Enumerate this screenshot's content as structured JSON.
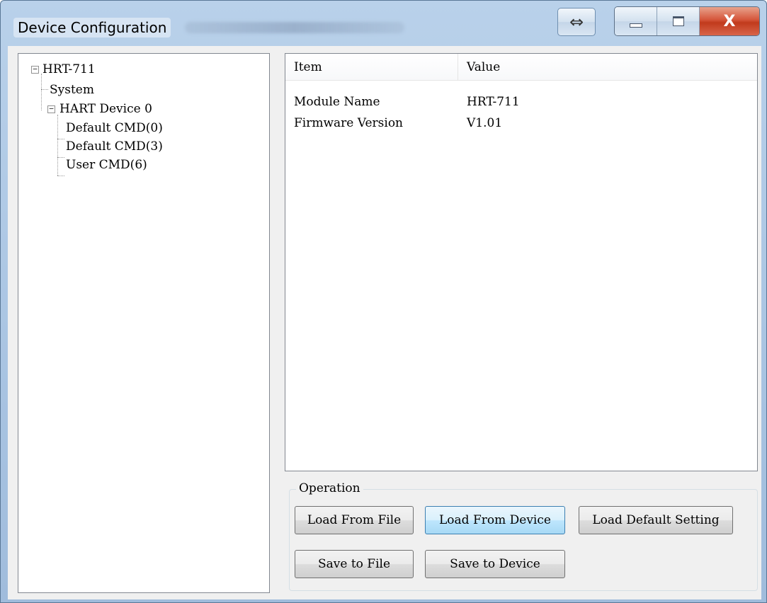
{
  "window": {
    "title": "Device Configuration",
    "snap_glyph": "⇔",
    "close_glyph": "X"
  },
  "tree": {
    "root": {
      "label": "HRT-711",
      "expander": "−"
    },
    "system": {
      "label": "System"
    },
    "hart_device": {
      "label": "HART Device 0",
      "expander": "−"
    },
    "children": [
      {
        "label": "Default CMD(0)"
      },
      {
        "label": "Default CMD(3)"
      },
      {
        "label": "User CMD(6)"
      }
    ]
  },
  "list": {
    "columns": {
      "item": "Item",
      "value": "Value"
    },
    "rows": [
      {
        "item": "Module Name",
        "value": "HRT-711"
      },
      {
        "item": "Firmware Version",
        "value": "V1.01"
      }
    ]
  },
  "operation": {
    "title": "Operation",
    "load_from_file": "Load From File",
    "load_from_device": "Load From Device",
    "load_default_setting": "Load Default Setting",
    "save_to_file": "Save to File",
    "save_to_device": "Save to Device"
  }
}
